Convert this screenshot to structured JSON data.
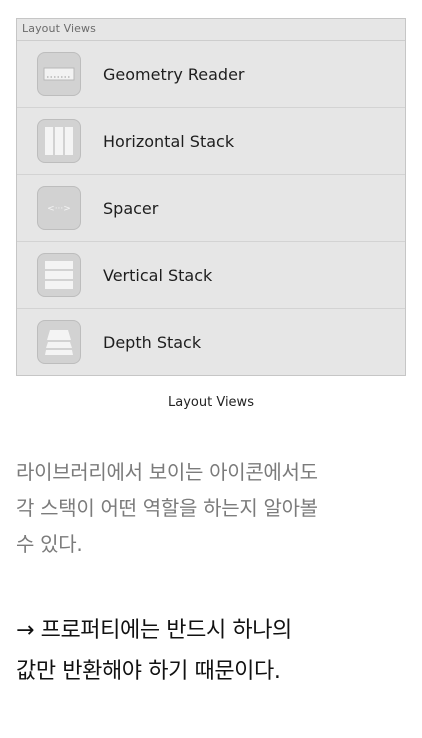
{
  "panel": {
    "header": "Layout Views",
    "items": [
      {
        "label": "Geometry Reader",
        "icon": "geometry-reader-icon"
      },
      {
        "label": "Horizontal Stack",
        "icon": "horizontal-stack-icon"
      },
      {
        "label": "Spacer",
        "icon": "spacer-icon"
      },
      {
        "label": "Vertical Stack",
        "icon": "vertical-stack-icon"
      },
      {
        "label": "Depth Stack",
        "icon": "depth-stack-icon"
      }
    ]
  },
  "caption": "Layout Views",
  "paragraph": {
    "lines": [
      "라이브러리에서 보이는 아이콘에서도",
      "각 스택이 어떤 역할을 하는지 알아볼",
      "수 있다."
    ]
  },
  "emphasis": {
    "lines": [
      "→ 프로퍼티에는 반드시 하나의",
      "값만 반환해야 하기 때문이다."
    ]
  }
}
